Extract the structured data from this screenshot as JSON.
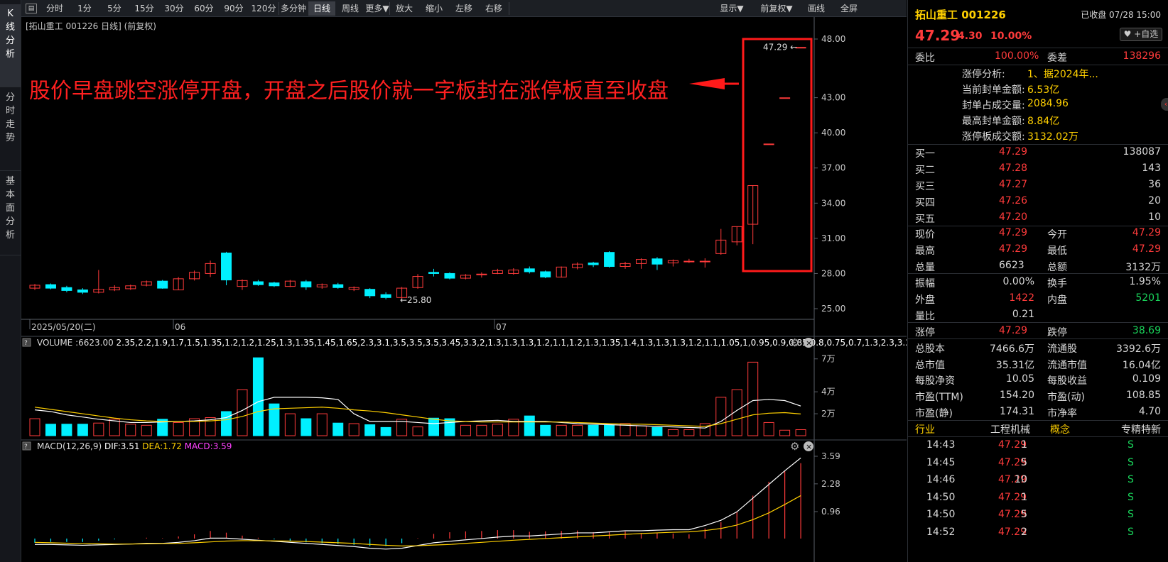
{
  "toolbar": {
    "items": [
      "分时",
      "1分",
      "5分",
      "15分",
      "30分",
      "60分",
      "90分",
      "120分",
      "多分钟",
      "日线",
      "周线",
      "更多▼",
      "放大",
      "缩小",
      "左移",
      "右移"
    ],
    "right_items": [
      "显示▼",
      "前复权▼",
      "画线",
      "全屏"
    ],
    "selected": "日线"
  },
  "side_tabs": [
    {
      "label": "K线分析",
      "active": true
    },
    {
      "label": "分时走势",
      "active": false
    },
    {
      "label": "基本面分析",
      "active": false
    }
  ],
  "chart_header": "[拓山重工 001226 日线]  (前复权)",
  "annotation": "股价早盘跳空涨停开盘，开盘之后股价就一字板封在涨停板直至收盘",
  "chart_data": {
    "type": "candlestick",
    "price_axis": [
      "48.00",
      "43.00",
      "40.00",
      "37.00",
      "34.00",
      "31.00",
      "28.00",
      "25.00"
    ],
    "date_labels": [
      "2025/05/20(二)",
      "06",
      "07"
    ],
    "max_label": "47.29",
    "min_label": "25.80",
    "candles": [
      {
        "o": 26.75,
        "c": 27.0,
        "h": 27.1,
        "l": 26.6
      },
      {
        "o": 27.05,
        "c": 26.75,
        "h": 27.15,
        "l": 26.65
      },
      {
        "o": 26.8,
        "c": 26.55,
        "h": 26.95,
        "l": 26.4
      },
      {
        "o": 26.6,
        "c": 26.4,
        "h": 26.75,
        "l": 26.25
      },
      {
        "o": 26.4,
        "c": 26.65,
        "h": 28.3,
        "l": 26.3
      },
      {
        "o": 26.6,
        "c": 26.8,
        "h": 27.0,
        "l": 26.5
      },
      {
        "o": 26.7,
        "c": 26.95,
        "h": 27.05,
        "l": 26.6
      },
      {
        "o": 27.0,
        "c": 27.3,
        "h": 27.4,
        "l": 26.9
      },
      {
        "o": 27.35,
        "c": 26.75,
        "h": 27.45,
        "l": 26.7
      },
      {
        "o": 26.6,
        "c": 27.55,
        "h": 27.7,
        "l": 26.6
      },
      {
        "o": 27.55,
        "c": 28.1,
        "h": 28.25,
        "l": 27.4
      },
      {
        "o": 28.0,
        "c": 28.85,
        "h": 29.1,
        "l": 27.7
      },
      {
        "o": 29.75,
        "c": 27.45,
        "h": 29.85,
        "l": 27.0
      },
      {
        "o": 26.9,
        "c": 27.4,
        "h": 27.5,
        "l": 26.6
      },
      {
        "o": 27.3,
        "c": 27.05,
        "h": 27.45,
        "l": 26.95
      },
      {
        "o": 27.2,
        "c": 26.95,
        "h": 27.3,
        "l": 26.85
      },
      {
        "o": 26.9,
        "c": 27.35,
        "h": 27.45,
        "l": 26.85
      },
      {
        "o": 27.3,
        "c": 26.85,
        "h": 27.45,
        "l": 26.6
      },
      {
        "o": 26.85,
        "c": 27.05,
        "h": 27.15,
        "l": 26.7
      },
      {
        "o": 27.05,
        "c": 26.8,
        "h": 27.2,
        "l": 26.7
      },
      {
        "o": 26.65,
        "c": 26.8,
        "h": 26.9,
        "l": 26.5
      },
      {
        "o": 26.65,
        "c": 26.1,
        "h": 26.75,
        "l": 25.9
      },
      {
        "o": 26.2,
        "c": 25.95,
        "h": 26.4,
        "l": 25.8
      },
      {
        "o": 25.95,
        "c": 26.75,
        "h": 26.85,
        "l": 25.8
      },
      {
        "o": 26.8,
        "c": 27.75,
        "h": 27.95,
        "l": 26.7
      },
      {
        "o": 28.1,
        "c": 28.0,
        "h": 28.4,
        "l": 27.75
      },
      {
        "o": 28.0,
        "c": 27.6,
        "h": 28.1,
        "l": 27.5
      },
      {
        "o": 27.6,
        "c": 27.85,
        "h": 27.95,
        "l": 27.5
      },
      {
        "o": 27.9,
        "c": 27.95,
        "h": 28.1,
        "l": 27.65
      },
      {
        "o": 28.0,
        "c": 28.25,
        "h": 28.4,
        "l": 27.95
      },
      {
        "o": 28.0,
        "c": 28.3,
        "h": 28.45,
        "l": 27.9
      },
      {
        "o": 28.4,
        "c": 28.15,
        "h": 28.6,
        "l": 28.0
      },
      {
        "o": 28.15,
        "c": 27.7,
        "h": 28.25,
        "l": 27.6
      },
      {
        "o": 27.7,
        "c": 28.55,
        "h": 28.6,
        "l": 27.65
      },
      {
        "o": 28.5,
        "c": 28.8,
        "h": 28.95,
        "l": 28.35
      },
      {
        "o": 28.9,
        "c": 28.75,
        "h": 29.0,
        "l": 28.55
      },
      {
        "o": 29.8,
        "c": 28.6,
        "h": 29.9,
        "l": 28.5
      },
      {
        "o": 28.6,
        "c": 28.85,
        "h": 29.0,
        "l": 28.4
      },
      {
        "o": 28.85,
        "c": 29.2,
        "h": 29.3,
        "l": 28.4
      },
      {
        "o": 29.25,
        "c": 28.8,
        "h": 29.4,
        "l": 28.3
      },
      {
        "o": 28.9,
        "c": 29.1,
        "h": 29.2,
        "l": 28.6
      },
      {
        "o": 29.0,
        "c": 29.05,
        "h": 29.25,
        "l": 28.9
      },
      {
        "o": 29.0,
        "c": 29.05,
        "h": 29.3,
        "l": 28.5
      },
      {
        "o": 29.7,
        "c": 30.85,
        "h": 31.8,
        "l": 29.6
      },
      {
        "o": 30.7,
        "c": 32.0,
        "h": 32.0,
        "l": 30.4
      },
      {
        "o": 32.2,
        "c": 35.5,
        "h": 35.5,
        "l": 30.5
      },
      {
        "o": 39.05,
        "c": 39.05,
        "h": 39.05,
        "l": 39.05
      },
      {
        "o": 42.99,
        "c": 42.99,
        "h": 42.99,
        "l": 42.99
      },
      {
        "o": 47.29,
        "c": 47.29,
        "h": 47.29,
        "l": 47.29
      }
    ],
    "volume": {
      "title": "VOLUME",
      "vol": ":6623.00",
      "ma5": [
        2.35,
        2.2,
        1.9,
        1.7,
        1.5,
        1.35,
        1.2,
        1.2,
        1.25,
        1.3,
        1.35,
        1.45,
        1.65,
        2.3,
        3.1,
        3.5,
        3.5,
        3.5,
        3.45,
        3.3,
        2.0,
        1.3,
        1.3,
        1.3,
        1.2,
        1.1,
        1.2,
        1.3,
        1.35,
        1.4,
        1.3,
        1.3,
        1.3,
        1.2,
        1.1,
        1.05,
        1.0,
        0.95,
        0.9,
        0.85,
        0.8,
        0.75,
        0.7,
        1.3,
        2.3,
        3.2,
        3.3,
        3.2,
        2.7
      ],
      "ma10": [
        2.6,
        2.4,
        2.2,
        2.0,
        1.8,
        1.6,
        1.45,
        1.35,
        1.3,
        1.3,
        1.3,
        1.35,
        1.45,
        1.75,
        2.2,
        2.45,
        2.5,
        2.55,
        2.6,
        2.5,
        2.35,
        2.25,
        2.1,
        1.9,
        1.7,
        1.5,
        1.35,
        1.3,
        1.25,
        1.25,
        1.25,
        1.25,
        1.25,
        1.25,
        1.2,
        1.15,
        1.1,
        1.05,
        1.05,
        1.0,
        0.95,
        0.9,
        0.85,
        1.1,
        1.5,
        1.9,
        2.05,
        2.1,
        1.98
      ],
      "axis": [
        "7万",
        "4万",
        "2万"
      ],
      "values": [
        1.55,
        1.05,
        1.05,
        1.05,
        1.15,
        1.5,
        1.05,
        0.95,
        1.5,
        1.2,
        1.55,
        1.65,
        2.2,
        4.2,
        7.1,
        2.9,
        2.0,
        1.55,
        2.0,
        1.15,
        1.1,
        1.0,
        0.75,
        1.5,
        0.8,
        1.6,
        1.55,
        0.95,
        0.95,
        1.05,
        1.5,
        1.8,
        0.95,
        0.95,
        0.95,
        0.95,
        0.95,
        1.1,
        0.9,
        0.75,
        0.55,
        0.55,
        1.1,
        3.5,
        4.2,
        6.7,
        1.2,
        0.5,
        0.55
      ]
    },
    "macd": {
      "title": "MACD(12,26,9)",
      "dif": "DIF:3.51",
      "dea": "DEA:1.72",
      "macd": "MACD:3.59",
      "axis": [
        "3.59",
        "2.28",
        "0.96"
      ],
      "dif_series": [
        -0.6,
        -0.6,
        -0.62,
        -0.64,
        -0.62,
        -0.6,
        -0.58,
        -0.55,
        -0.55,
        -0.5,
        -0.42,
        -0.3,
        -0.3,
        -0.35,
        -0.4,
        -0.45,
        -0.5,
        -0.55,
        -0.6,
        -0.65,
        -0.7,
        -0.78,
        -0.82,
        -0.78,
        -0.65,
        -0.52,
        -0.45,
        -0.38,
        -0.32,
        -0.25,
        -0.2,
        -0.2,
        -0.15,
        -0.1,
        -0.05,
        -0.05,
        0.0,
        0.05,
        0.05,
        0.08,
        0.1,
        0.1,
        0.3,
        0.55,
        0.95,
        1.6,
        2.25,
        2.9,
        3.51
      ],
      "dea_series": [
        -0.5,
        -0.52,
        -0.54,
        -0.56,
        -0.57,
        -0.58,
        -0.58,
        -0.57,
        -0.56,
        -0.55,
        -0.52,
        -0.48,
        -0.44,
        -0.42,
        -0.42,
        -0.43,
        -0.44,
        -0.46,
        -0.49,
        -0.52,
        -0.55,
        -0.6,
        -0.64,
        -0.67,
        -0.66,
        -0.63,
        -0.6,
        -0.55,
        -0.5,
        -0.45,
        -0.4,
        -0.36,
        -0.32,
        -0.28,
        -0.24,
        -0.2,
        -0.16,
        -0.12,
        -0.08,
        -0.05,
        -0.02,
        0.0,
        0.06,
        0.16,
        0.32,
        0.58,
        0.9,
        1.3,
        1.72
      ]
    }
  },
  "quote": {
    "name": "拓山重工",
    "code": "001226",
    "status": "已收盘 07/28 15:00",
    "price": "47.29",
    "change": "4.30",
    "pct": "10.00%",
    "fav": "+自选",
    "weibi_label": "委比",
    "weibi": "100.00%",
    "weicha_label": "委差",
    "weicha": "138296",
    "zt": [
      {
        "k": "涨停分析:",
        "v": "1、据2024年..."
      },
      {
        "k": "当前封单金额:",
        "v": "6.53亿"
      },
      {
        "k": "封单占成交量:",
        "v": "2084.96"
      },
      {
        "k": "最高封单金额:",
        "v": "8.84亿"
      },
      {
        "k": "涨停板成交额:",
        "v": "3132.02万"
      }
    ],
    "buy": [
      {
        "l": "买一",
        "p": "47.29",
        "v": "138087"
      },
      {
        "l": "买二",
        "p": "47.28",
        "v": "143"
      },
      {
        "l": "买三",
        "p": "47.27",
        "v": "36"
      },
      {
        "l": "买四",
        "p": "47.26",
        "v": "20"
      },
      {
        "l": "买五",
        "p": "47.20",
        "v": "10"
      }
    ],
    "stats1": [
      {
        "a": "现价",
        "av": "47.29",
        "b": "今开",
        "bv": "47.29"
      },
      {
        "a": "最高",
        "av": "47.29",
        "b": "最低",
        "bv": "47.29"
      },
      {
        "a": "总量",
        "av": "6623",
        "b": "总额",
        "bv": "3132万"
      }
    ],
    "stats2": [
      {
        "a": "振幅",
        "av": "0.00%",
        "b": "换手",
        "bv": "1.95%"
      },
      {
        "a": "外盘",
        "av": "1422",
        "b": "内盘",
        "bv": "5201"
      },
      {
        "a": "量比",
        "av": "0.21",
        "b": "",
        "bv": ""
      }
    ],
    "limit": {
      "up_label": "涨停",
      "up": "47.29",
      "down_label": "跌停",
      "down": "38.69"
    },
    "fund": [
      {
        "a": "总股本",
        "av": "7466.6万",
        "b": "流通股",
        "bv": "3392.6万"
      },
      {
        "a": "总市值",
        "av": "35.31亿",
        "b": "流通市值",
        "bv": "16.04亿"
      },
      {
        "a": "每股净资",
        "av": "10.05",
        "b": "每股收益",
        "bv": "0.109"
      },
      {
        "a": "市盈(TTM)",
        "av": "154.20",
        "b": "市盈(动)",
        "bv": "108.85"
      },
      {
        "a": "市盈(静)",
        "av": "174.31",
        "b": "市净率",
        "bv": "4.70"
      }
    ],
    "tags": [
      "行业",
      "工程机械",
      "概念",
      "专精特新"
    ],
    "ticks": [
      {
        "t": "14:43",
        "p": "47.29",
        "v": "1",
        "s": "S"
      },
      {
        "t": "14:45",
        "p": "47.29",
        "v": "5",
        "s": "S"
      },
      {
        "t": "14:46",
        "p": "47.29",
        "v": "10",
        "s": "S"
      },
      {
        "t": "14:50",
        "p": "47.29",
        "v": "1",
        "s": "S"
      },
      {
        "t": "14:50",
        "p": "47.29",
        "v": "5",
        "s": "S"
      },
      {
        "t": "14:52",
        "p": "47.29",
        "v": "2",
        "s": "S"
      }
    ]
  }
}
